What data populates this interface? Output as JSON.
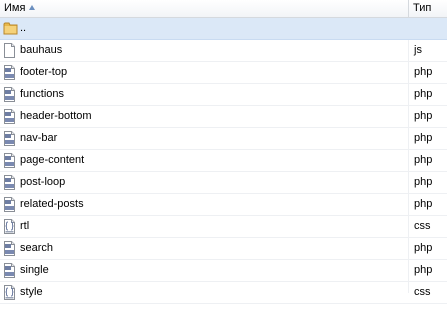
{
  "header": {
    "name_label": "Имя",
    "type_label": "Тип"
  },
  "parent": {
    "label": ".."
  },
  "files": [
    {
      "name": "bauhaus",
      "type": "js",
      "icon": "blank-file-icon"
    },
    {
      "name": "footer-top",
      "type": "php",
      "icon": "php-file-icon"
    },
    {
      "name": "functions",
      "type": "php",
      "icon": "php-file-icon"
    },
    {
      "name": "header-bottom",
      "type": "php",
      "icon": "php-file-icon"
    },
    {
      "name": "nav-bar",
      "type": "php",
      "icon": "php-file-icon"
    },
    {
      "name": "page-content",
      "type": "php",
      "icon": "php-file-icon"
    },
    {
      "name": "post-loop",
      "type": "php",
      "icon": "php-file-icon"
    },
    {
      "name": "related-posts",
      "type": "php",
      "icon": "php-file-icon"
    },
    {
      "name": "rtl",
      "type": "css",
      "icon": "css-file-icon"
    },
    {
      "name": "search",
      "type": "php",
      "icon": "php-file-icon"
    },
    {
      "name": "single",
      "type": "php",
      "icon": "php-file-icon"
    },
    {
      "name": "style",
      "type": "css",
      "icon": "css-file-icon"
    }
  ],
  "colors": {
    "selected_row": "#dbe8f7",
    "folder": "#e8b84a",
    "sort_arrow": "#6b8fbf"
  }
}
